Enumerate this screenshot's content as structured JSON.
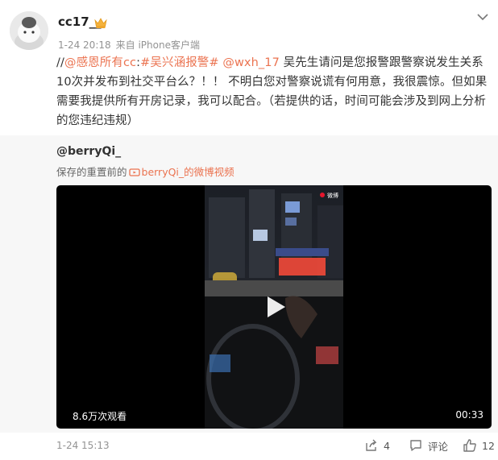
{
  "post": {
    "username": "cc17__",
    "time": "1-24 20:18",
    "source": "来自 iPhone客户端",
    "text": {
      "prefix": "//",
      "mention1": "@感恩所有cc",
      "colon": ":",
      "hashtag": "#吴兴涵报警#",
      "space": " ",
      "mention2": "@wxh_17",
      "body": " 吴先生请问是您报警跟警察说发生关系10次并发布到社交平台么？！！ 不明白您对警察说谎有何用意，我很震惊。但如果需要我提供所有开房记录，我可以配合。（若提供的话，时间可能会涉及到网上分析的您违纪违规）"
    },
    "footer": {
      "time": "1-24 15:13",
      "share_count": "4",
      "comment_label": "评论",
      "like_count": "12"
    }
  },
  "repost": {
    "username": "@berryQi_",
    "saved_prefix": "保存的重置前的",
    "saved_link": "berryQi_的微博视频"
  },
  "video": {
    "views": "8.6万次观看",
    "duration": "00:33",
    "watermark": "微博"
  },
  "icons": {
    "crown": "crown-icon",
    "chevron": "chevron-down-icon",
    "video_link": "video-link-icon",
    "play": "play-icon",
    "share": "share-icon",
    "comment": "comment-icon",
    "like": "like-icon"
  },
  "colors": {
    "link": "#eb7350",
    "meta": "#939393",
    "repost_bg": "#f7f7f7"
  }
}
